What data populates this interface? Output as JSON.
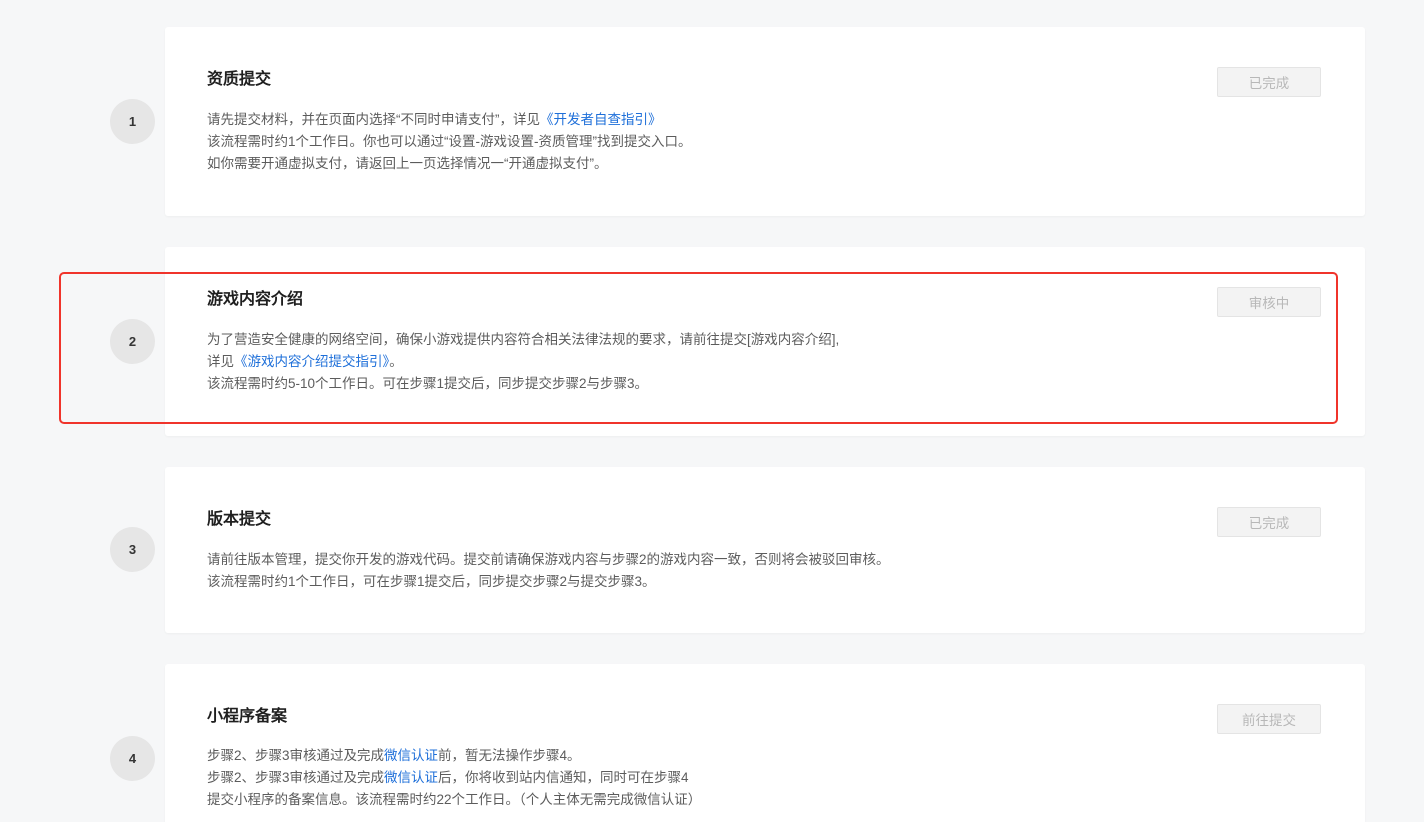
{
  "steps": [
    {
      "number": "1",
      "title": "资质提交",
      "status": "已完成",
      "desc": {
        "line1_pre": "请先提交材料，并在页面内选择“不同时申请支付”，详见",
        "line1_link": "《开发者自查指引》",
        "line2": "该流程需时约1个工作日。你也可以通过“设置-游戏设置-资质管理”找到提交入口。",
        "line3": "如你需要开通虚拟支付，请返回上一页选择情况一“开通虚拟支付”。"
      }
    },
    {
      "number": "2",
      "title": "游戏内容介绍",
      "status": "审核中",
      "desc": {
        "line1": "为了营造安全健康的网络空间，确保小游戏提供内容符合相关法律法规的要求，请前往提交[游戏内容介绍],",
        "line2_pre": "详见",
        "line2_link": "《游戏内容介绍提交指引》",
        "line2_post": "。",
        "line3": "该流程需时约5-10个工作日。可在步骤1提交后，同步提交步骤2与步骤3。"
      }
    },
    {
      "number": "3",
      "title": "版本提交",
      "status": "已完成",
      "desc": {
        "line1": "请前往版本管理，提交你开发的游戏代码。提交前请确保游戏内容与步骤2的游戏内容一致，否则将会被驳回审核。",
        "line2": "该流程需时约1个工作日，可在步骤1提交后，同步提交步骤2与提交步骤3。"
      }
    },
    {
      "number": "4",
      "title": "小程序备案",
      "status": "前往提交",
      "desc": {
        "line1_pre": "步骤2、步骤3审核通过及完成",
        "line1_link": "微信认证",
        "line1_post": "前，暂无法操作步骤4。",
        "line2_pre": "步骤2、步骤3审核通过及完成",
        "line2_link": "微信认证",
        "line2_post": "后，你将收到站内信通知，同时可在步骤4",
        "line3": "提交小程序的备案信息。该流程需时约22个工作日。（个人主体无需完成微信认证）"
      }
    }
  ],
  "colors": {
    "link": "#1e6fd9",
    "highlight": "#f0342b",
    "background": "#f6f7f8"
  }
}
